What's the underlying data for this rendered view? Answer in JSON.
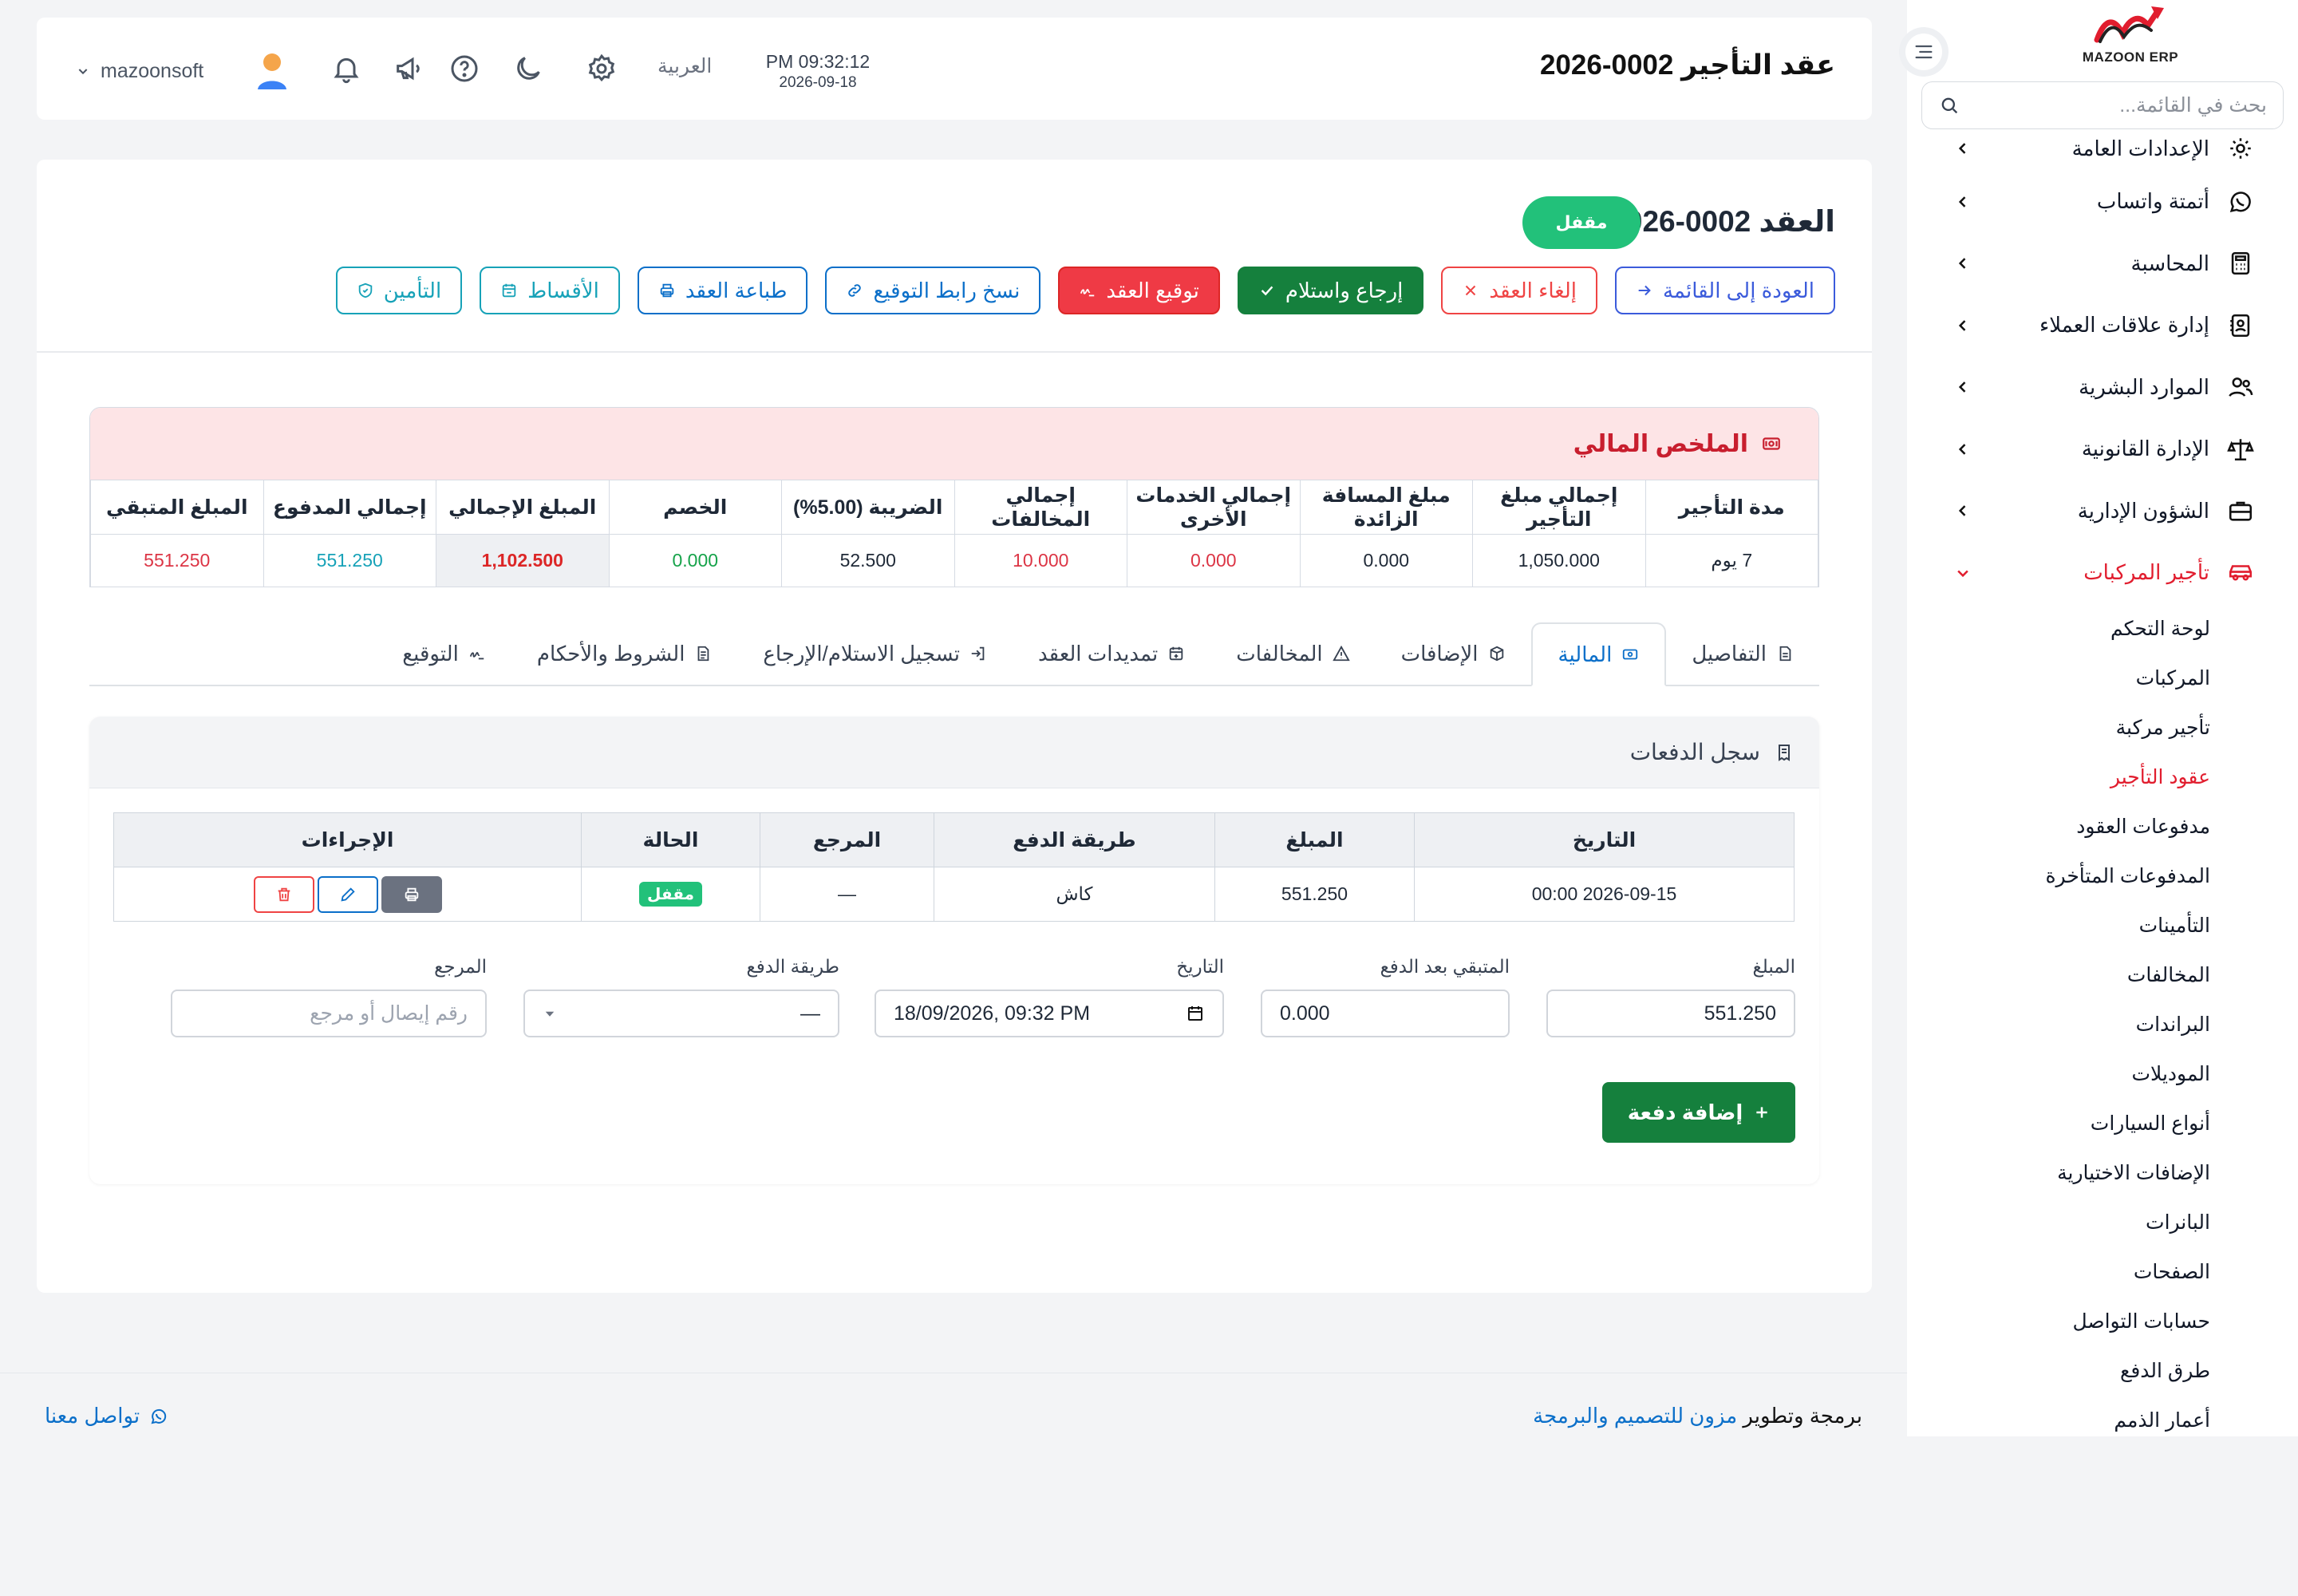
{
  "brand": {
    "logo_text": "MAZOON ERP",
    "accent": "#e11d2e",
    "primary": "#0b6fc9",
    "success": "#15803d"
  },
  "sidebar": {
    "search_placeholder": "بحث في القائمة...",
    "items": [
      {
        "label": "الإعدادات العامة",
        "icon": "gear-icon"
      },
      {
        "label": "أتمتة واتساب",
        "icon": "whatsapp-icon"
      },
      {
        "label": "المحاسبة",
        "icon": "calculator-icon"
      },
      {
        "label": "إدارة علاقات العملاء",
        "icon": "contacts-icon"
      },
      {
        "label": "الموارد البشرية",
        "icon": "users-icon"
      },
      {
        "label": "الإدارة القانونية",
        "icon": "scale-icon"
      },
      {
        "label": "الشؤون الإدارية",
        "icon": "briefcase-icon"
      },
      {
        "label": "تأجير المركبات",
        "icon": "car-icon"
      }
    ],
    "submenu": [
      "لوحة التحكم",
      "المركبات",
      "تأجير مركبة",
      "عقود التأجير",
      "مدفوعات العقود",
      "المدفوعات المتأخرة",
      "التأمينات",
      "المخالفات",
      "البراندات",
      "الموديلات",
      "أنواع السيارات",
      "الإضافات الاختيارية",
      "البانرات",
      "الصفحات",
      "حسابات التواصل",
      "طرق الدفع",
      "أعمار الذمم"
    ]
  },
  "topbar": {
    "page_title": "عقد التأجير 0002-2026",
    "time": "PM 09:32:12",
    "date": "2026-09-18",
    "language": "العربية",
    "username": "mazoonsoft"
  },
  "contract": {
    "title": "العقد 0002-2026",
    "status": "مقفل",
    "actions": {
      "back": "العودة إلى القائمة",
      "cancel": "إلغاء العقد",
      "return": "إرجاع واستلام",
      "sign": "توقيع العقد",
      "copy_link": "نسخ رابط التوقيع",
      "print": "طباعة العقد",
      "installments": "الأقساط",
      "insurance": "التأمين"
    }
  },
  "summary": {
    "title": "الملخص المالي",
    "headers": [
      "مدة التأجير",
      "إجمالي مبلغ التأجير",
      "مبلغ المسافة الزائدة",
      "إجمالي الخدمات الأخرى",
      "إجمالي المخالفات",
      "الضريبة (5.00%)",
      "الخصم",
      "المبلغ الإجمالي",
      "إجمالي المدفوع",
      "المبلغ المتبقي"
    ],
    "values": [
      "7 يوم",
      "1,050.000",
      "0.000",
      "0.000",
      "10.000",
      "52.500",
      "0.000",
      "1,102.500",
      "551.250",
      "551.250"
    ]
  },
  "tabs": [
    "التفاصيل",
    "المالية",
    "الإضافات",
    "المخالفات",
    "تمديدات العقد",
    "تسجيل الاستلام/الإرجاع",
    "الشروط والأحكام",
    "التوقيع"
  ],
  "payments": {
    "title": "سجل الدفعات",
    "headers": [
      "التاريخ",
      "المبلغ",
      "طريقة الدفع",
      "المرجع",
      "الحالة",
      "الإجراءات"
    ],
    "rows": [
      {
        "date": "2026-09-15 00:00",
        "amount": "551.250",
        "method": "كاش",
        "ref": "—",
        "status": "مقفل"
      }
    ],
    "form": {
      "amount_label": "المبلغ",
      "amount_value": "551.250",
      "remaining_label": "المتبقي بعد الدفع",
      "remaining_value": "0.000",
      "date_label": "التاريخ",
      "date_value": "18/09/2026, 09:32 PM",
      "method_label": "طريقة الدفع",
      "method_value": "—",
      "ref_label": "المرجع",
      "ref_placeholder": "رقم إيصال أو مرجع"
    },
    "add_button": "إضافة دفعة"
  },
  "footer": {
    "credit_prefix": "برمجة وتطوير",
    "credit_link": "مزون للتصميم والبرمجة",
    "contact": "تواصل معنا"
  }
}
